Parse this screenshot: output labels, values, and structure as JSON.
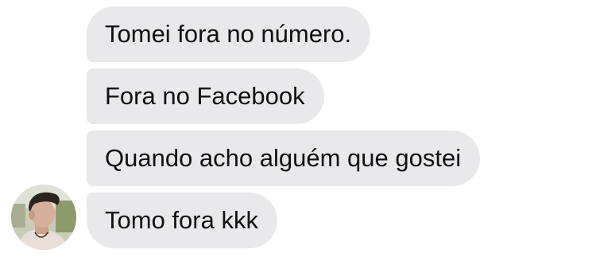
{
  "thread": {
    "messages": [
      {
        "text": "Tomei fora no número."
      },
      {
        "text": "Fora no Facebook"
      },
      {
        "text": "Quando acho alguém que gostei"
      },
      {
        "text": "Tomo fora kkk"
      }
    ],
    "sender": {
      "avatar_icon": "user-photo-avatar"
    }
  },
  "colors": {
    "bubble_background": "#e9e9eb",
    "bubble_text": "#111111",
    "page_background": "#ffffff"
  }
}
